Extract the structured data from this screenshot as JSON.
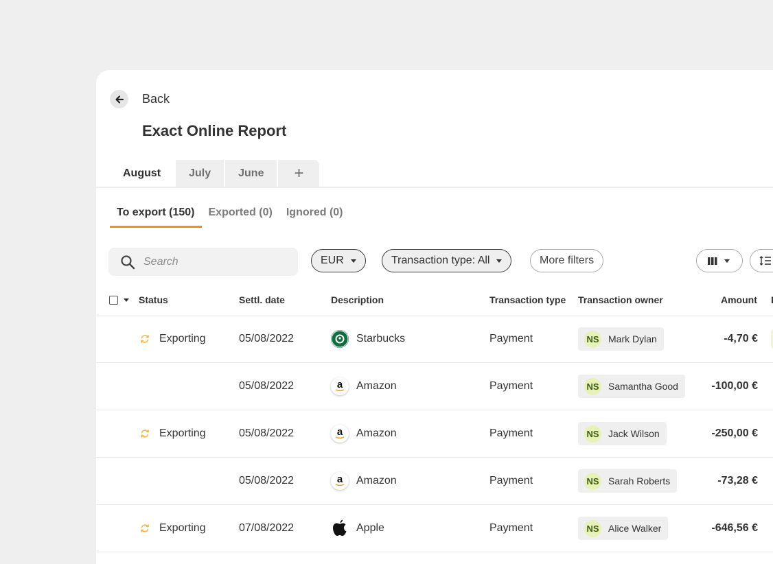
{
  "header": {
    "back_label": "Back",
    "title": "Exact Online Report"
  },
  "period_tabs": [
    "August",
    "July",
    "June"
  ],
  "add_tab_symbol": "+",
  "status_tabs": [
    "To export (150)",
    "Exported (0)",
    "Ignored (0)"
  ],
  "filters": {
    "search_placeholder": "Search",
    "currency": "EUR",
    "transaction_type": "Transaction type: All",
    "more_filters": "More filters"
  },
  "columns": {
    "status": "Status",
    "date": "Settl. date",
    "description": "Description",
    "type": "Transaction type",
    "owner": "Transaction owner",
    "amount": "Amount",
    "extra": "E"
  },
  "rows": [
    {
      "status": "Exporting",
      "date": "05/08/2022",
      "merchant": "Starbucks",
      "logo": "starbucks-logo",
      "type": "Payment",
      "owner_initials": "NS",
      "owner": "Mark Dylan",
      "amount": "-4,70 €"
    },
    {
      "status": "",
      "date": "05/08/2022",
      "merchant": "Amazon",
      "logo": "amazon-logo",
      "type": "Payment",
      "owner_initials": "NS",
      "owner": "Samantha Good",
      "amount": "-100,00 €"
    },
    {
      "status": "Exporting",
      "date": "05/08/2022",
      "merchant": "Amazon",
      "logo": "amazon-logo",
      "type": "Payment",
      "owner_initials": "NS",
      "owner": "Jack Wilson",
      "amount": "-250,00 €"
    },
    {
      "status": "",
      "date": "05/08/2022",
      "merchant": "Amazon",
      "logo": "amazon-logo",
      "type": "Payment",
      "owner_initials": "NS",
      "owner": "Sarah Roberts",
      "amount": "-73,28 €"
    },
    {
      "status": "Exporting",
      "date": "07/08/2022",
      "merchant": "Apple",
      "logo": "apple-logo",
      "type": "Payment",
      "owner_initials": "NS",
      "owner": "Alice Walker",
      "amount": "-646,56 €"
    }
  ],
  "colors": {
    "accent": "#f08c2a",
    "sync_icon": "#f3b64b",
    "avatar_bg": "#e6f2b8"
  }
}
